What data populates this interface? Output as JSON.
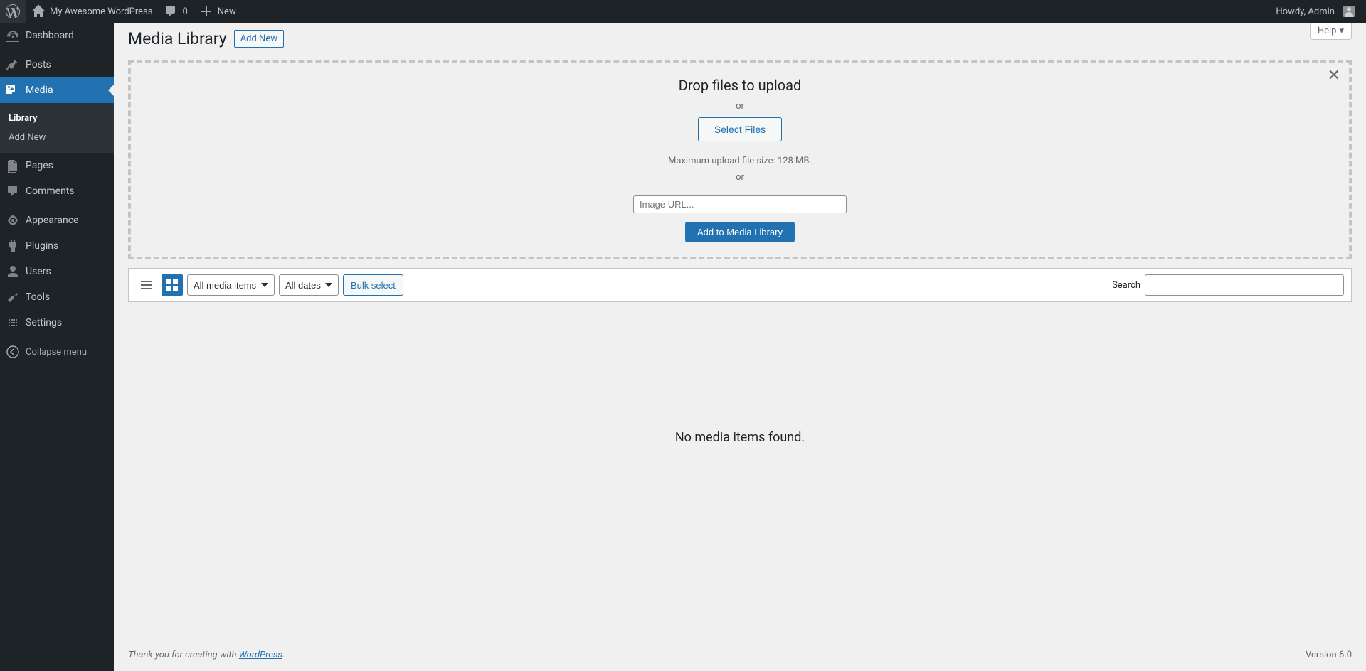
{
  "adminBar": {
    "siteName": "My Awesome WordPress",
    "commentsCount": "0",
    "newLabel": "New",
    "howdy": "Howdy, Admin"
  },
  "sidebar": {
    "dashboard": "Dashboard",
    "posts": "Posts",
    "media": "Media",
    "submenu": {
      "library": "Library",
      "addNew": "Add New"
    },
    "pages": "Pages",
    "comments": "Comments",
    "appearance": "Appearance",
    "plugins": "Plugins",
    "users": "Users",
    "tools": "Tools",
    "settings": "Settings",
    "collapse": "Collapse menu"
  },
  "header": {
    "title": "Media Library",
    "addNew": "Add New",
    "help": "Help"
  },
  "upload": {
    "dropTitle": "Drop files to upload",
    "or1": "or",
    "selectFiles": "Select Files",
    "maxSize": "Maximum upload file size: 128 MB.",
    "or2": "or",
    "urlPlaceholder": "Image URL...",
    "addToLibrary": "Add to Media Library"
  },
  "filters": {
    "mediaItems": "All media items",
    "dates": "All dates",
    "bulkSelect": "Bulk select",
    "searchLabel": "Search"
  },
  "emptyMessage": "No media items found.",
  "footer": {
    "thankYou": "Thank you for creating with ",
    "linkText": "WordPress",
    "period": ".",
    "version": "Version 6.0"
  }
}
